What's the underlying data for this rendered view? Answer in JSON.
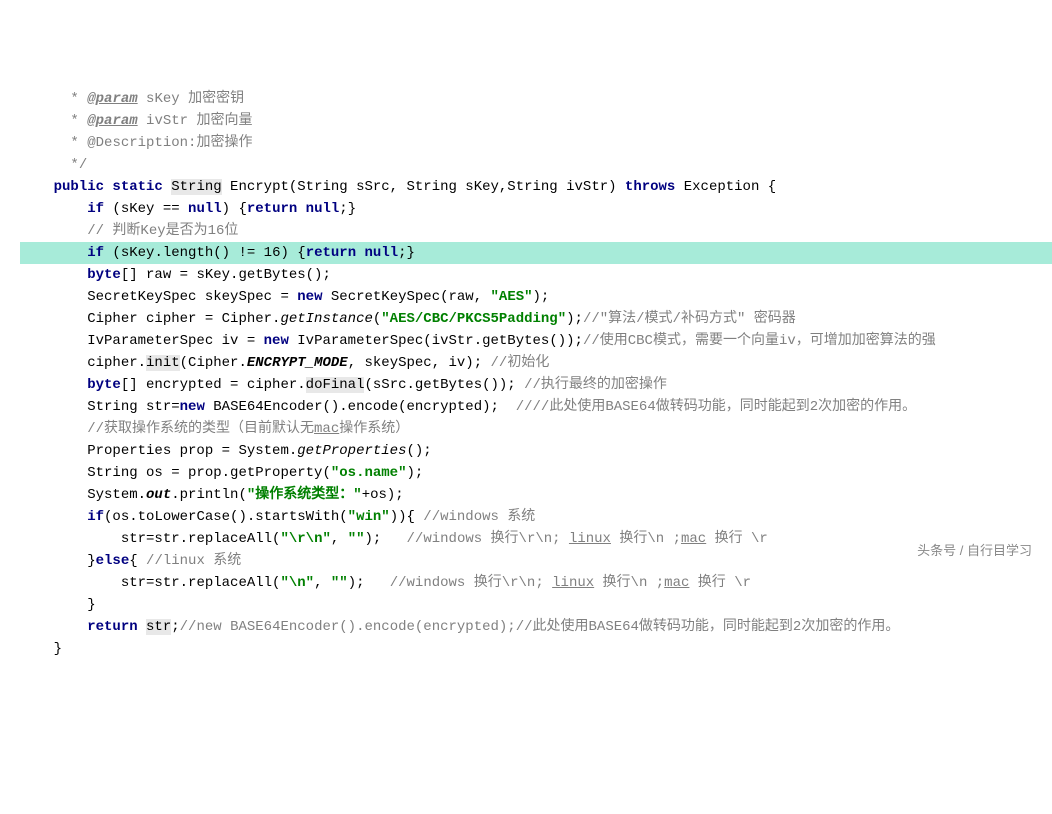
{
  "code": {
    "lines": [
      {
        "indent": "     ",
        "tokens": [
          {
            "t": " * ",
            "c": "javadoc"
          },
          {
            "t": "@param",
            "c": "javadoc-tag"
          },
          {
            "t": " sKey 加密密钥",
            "c": "javadoc"
          }
        ]
      },
      {
        "indent": "     ",
        "tokens": [
          {
            "t": " * ",
            "c": "javadoc"
          },
          {
            "t": "@param",
            "c": "javadoc-tag"
          },
          {
            "t": " ivStr 加密向量",
            "c": "javadoc"
          }
        ]
      },
      {
        "indent": "     ",
        "tokens": [
          {
            "t": " * ",
            "c": "javadoc"
          },
          {
            "t": "@Description:",
            "c": "javadoc"
          },
          {
            "t": "加密操作",
            "c": "javadoc"
          }
        ]
      },
      {
        "indent": "     ",
        "tokens": [
          {
            "t": " */",
            "c": "javadoc"
          }
        ]
      },
      {
        "indent": "    ",
        "tokens": [
          {
            "t": "public static ",
            "c": "keyword"
          },
          {
            "t": "String",
            "c": "boxed"
          },
          {
            "t": " Encrypt(String sSrc, String sKey,String ivStr) "
          },
          {
            "t": "throws",
            "c": "keyword"
          },
          {
            "t": " Exception {"
          }
        ]
      },
      {
        "indent": "        ",
        "tokens": [
          {
            "t": "if",
            "c": "keyword"
          },
          {
            "t": " (sKey == "
          },
          {
            "t": "null",
            "c": "keyword"
          },
          {
            "t": ") {"
          },
          {
            "t": "return null",
            "c": "keyword"
          },
          {
            "t": ";}"
          }
        ]
      },
      {
        "indent": "        ",
        "tokens": [
          {
            "t": "// 判断Key是否为16位",
            "c": "comment"
          }
        ]
      },
      {
        "indent": "        ",
        "highlight": true,
        "tokens": [
          {
            "t": "if",
            "c": "keyword"
          },
          {
            "t": " (sKey.length() != "
          },
          {
            "t": "16",
            "c": ""
          },
          {
            "t": ") {"
          },
          {
            "t": "return null",
            "c": "keyword"
          },
          {
            "t": ";}"
          }
        ]
      },
      {
        "indent": "        ",
        "tokens": [
          {
            "t": "byte",
            "c": "keyword"
          },
          {
            "t": "[] raw = sKey.getBytes();"
          }
        ]
      },
      {
        "indent": "        ",
        "tokens": [
          {
            "t": "SecretKeySpec skeySpec = "
          },
          {
            "t": "new",
            "c": "keyword"
          },
          {
            "t": " SecretKeySpec(raw, "
          },
          {
            "t": "\"AES\"",
            "c": "string"
          },
          {
            "t": ");"
          }
        ]
      },
      {
        "indent": "        ",
        "tokens": [
          {
            "t": "Cipher cipher = Cipher."
          },
          {
            "t": "getInstance",
            "c": "method-call"
          },
          {
            "t": "("
          },
          {
            "t": "\"AES/CBC/PKCS5Padding\"",
            "c": "string"
          },
          {
            "t": ");"
          },
          {
            "t": "//\"算法/模式/补码方式\" 密码器",
            "c": "comment"
          }
        ]
      },
      {
        "indent": "        ",
        "tokens": [
          {
            "t": "IvParameterSpec iv = "
          },
          {
            "t": "new",
            "c": "keyword"
          },
          {
            "t": " IvParameterSpec(ivStr.getBytes());"
          },
          {
            "t": "//使用CBC模式，需要一个向量iv，可增加加密算法的强",
            "c": "comment"
          }
        ]
      },
      {
        "indent": "        ",
        "tokens": [
          {
            "t": "cipher."
          },
          {
            "t": "init",
            "c": "boxed"
          },
          {
            "t": "(Cipher."
          },
          {
            "t": "ENCRYPT_MODE",
            "c": "static-field"
          },
          {
            "t": ", skeySpec, iv); "
          },
          {
            "t": "//初始化",
            "c": "comment"
          }
        ]
      },
      {
        "indent": "        ",
        "tokens": [
          {
            "t": "byte",
            "c": "keyword"
          },
          {
            "t": "[] encrypted = cipher."
          },
          {
            "t": "doFinal",
            "c": "boxed"
          },
          {
            "t": "(sSrc.getBytes()); "
          },
          {
            "t": "//执行最终的加密操作",
            "c": "comment"
          }
        ]
      },
      {
        "indent": "        ",
        "tokens": [
          {
            "t": "String str="
          },
          {
            "t": "new",
            "c": "keyword"
          },
          {
            "t": " BASE64Encoder().encode(encrypted);  "
          },
          {
            "t": "////此处使用BASE64做转码功能，同时能起到2次加密的作用。",
            "c": "comment"
          }
        ]
      },
      {
        "indent": "        ",
        "tokens": [
          {
            "t": "//获取操作系统的类型（目前默认无",
            "c": "comment"
          },
          {
            "t": "mac",
            "c": "comment underline"
          },
          {
            "t": "操作系统）",
            "c": "comment"
          }
        ]
      },
      {
        "indent": "        ",
        "tokens": [
          {
            "t": "Properties prop = System."
          },
          {
            "t": "getProperties",
            "c": "method-call"
          },
          {
            "t": "();"
          }
        ]
      },
      {
        "indent": "        ",
        "tokens": [
          {
            "t": "String os = prop.getProperty("
          },
          {
            "t": "\"os.name\"",
            "c": "string"
          },
          {
            "t": ");"
          }
        ]
      },
      {
        "indent": "        ",
        "tokens": [
          {
            "t": "System."
          },
          {
            "t": "out",
            "c": "static-field"
          },
          {
            "t": ".println("
          },
          {
            "t": "\"操作系统类型：\"",
            "c": "string"
          },
          {
            "t": "+os);"
          }
        ]
      },
      {
        "indent": "        ",
        "tokens": [
          {
            "t": "if",
            "c": "keyword"
          },
          {
            "t": "(os.toLowerCase().startsWith("
          },
          {
            "t": "\"win\"",
            "c": "string"
          },
          {
            "t": ")){ "
          },
          {
            "t": "//windows 系统",
            "c": "comment"
          }
        ]
      },
      {
        "indent": "            ",
        "tokens": [
          {
            "t": "str=str.replaceAll("
          },
          {
            "t": "\"\\r\\n\"",
            "c": "string"
          },
          {
            "t": ", "
          },
          {
            "t": "\"\"",
            "c": "string"
          },
          {
            "t": ");   "
          },
          {
            "t": "//windows 换行\\r\\n; ",
            "c": "comment"
          },
          {
            "t": "linux",
            "c": "comment underline"
          },
          {
            "t": " 换行\\n ;",
            "c": "comment"
          },
          {
            "t": "mac",
            "c": "comment underline"
          },
          {
            "t": " 换行 \\r",
            "c": "comment"
          }
        ]
      },
      {
        "indent": "        ",
        "tokens": [
          {
            "t": "}"
          },
          {
            "t": "else",
            "c": "keyword"
          },
          {
            "t": "{ "
          },
          {
            "t": "//linux 系统",
            "c": "comment"
          }
        ]
      },
      {
        "indent": "            ",
        "tokens": [
          {
            "t": "str=str.replaceAll("
          },
          {
            "t": "\"\\n\"",
            "c": "string"
          },
          {
            "t": ", "
          },
          {
            "t": "\"\"",
            "c": "string"
          },
          {
            "t": ");   "
          },
          {
            "t": "//windows 换行\\r\\n; ",
            "c": "comment"
          },
          {
            "t": "linux",
            "c": "comment underline"
          },
          {
            "t": " 换行\\n ;",
            "c": "comment"
          },
          {
            "t": "mac",
            "c": "comment underline"
          },
          {
            "t": " 换行 \\r",
            "c": "comment"
          }
        ]
      },
      {
        "indent": "        ",
        "tokens": [
          {
            "t": "}"
          }
        ]
      },
      {
        "indent": "        ",
        "tokens": [
          {
            "t": "return ",
            "c": "keyword"
          },
          {
            "t": "str",
            "c": "boxed"
          },
          {
            "t": ";"
          },
          {
            "t": "//new BASE64Encoder().encode(encrypted);//此处使用BASE64做转码功能，同时能起到2次加密的作用。",
            "c": "comment"
          }
        ]
      },
      {
        "indent": "    ",
        "tokens": [
          {
            "t": "}"
          }
        ]
      }
    ]
  },
  "watermark": "头条号 / 自行目学习"
}
